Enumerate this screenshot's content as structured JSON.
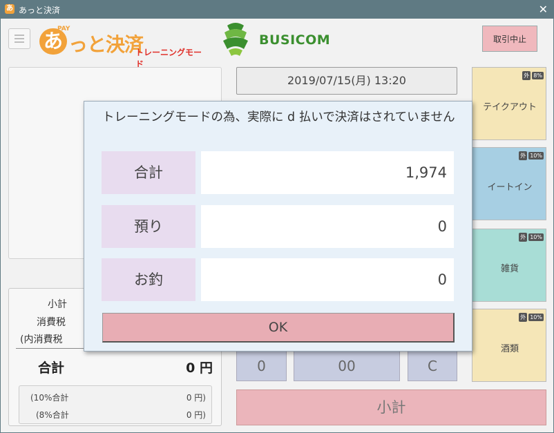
{
  "window": {
    "title": "あっと決済",
    "app_icon_glyph": "あ"
  },
  "header": {
    "logo": {
      "pay": "PAY",
      "a": "あ",
      "brand": "っと決済",
      "mode": "トレーニングモード"
    },
    "partner_logo": "BUSICOM",
    "cancel_label": "取引中止"
  },
  "datetime": "2019/07/15(月) 13:20",
  "categories": [
    {
      "label": "テイクアウト",
      "badge_type": "外",
      "badge_rate": "8%",
      "color": "#f5e6b7"
    },
    {
      "label": "イートイン",
      "badge_type": "外",
      "badge_rate": "10%",
      "color": "#a7cfe3"
    },
    {
      "label": "雑貨",
      "badge_type": "外",
      "badge_rate": "10%",
      "color": "#a8ddd6"
    },
    {
      "label": "酒類",
      "badge_type": "外",
      "badge_rate": "10%",
      "color": "#f5e6b7"
    }
  ],
  "totals": {
    "subtotal_label": "小計",
    "tax_label": "消費税",
    "inner_tax_label": "(内消費税",
    "total_label": "合計",
    "total_value": "0 円",
    "tax10_label": "(10%合計",
    "tax10_value": "0 円)",
    "tax8_label": "(8%合計",
    "tax8_value": "0 円)"
  },
  "keypad": {
    "zero": "0",
    "double_zero": "00",
    "clear": "C"
  },
  "subtotal_button": "小計",
  "dialog": {
    "message": "トレーニングモードの為、実際に d 払いで決済はされていません",
    "rows": [
      {
        "label": "合計",
        "value": "1,974"
      },
      {
        "label": "預り",
        "value": "0"
      },
      {
        "label": "お釣",
        "value": "0"
      }
    ],
    "ok_label": "OK"
  },
  "colors": {
    "titlebar": "#5f7a83",
    "brand_orange": "#f2a23a",
    "mode_red": "#e0312b",
    "busicom_green": "#3b8f2f",
    "dialog_bg": "#e8f1f9",
    "label_bg": "#e8dcef",
    "ok_bg": "#e8adb4"
  }
}
